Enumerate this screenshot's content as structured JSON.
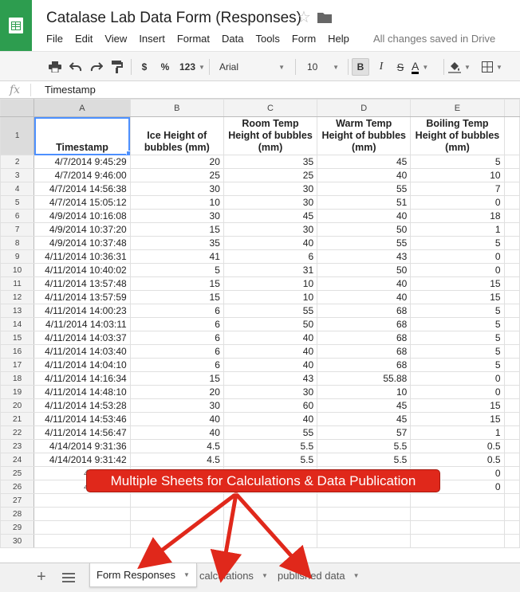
{
  "doc": {
    "title": "Catalase Lab Data Form (Responses)",
    "save_status": "All changes saved in Drive"
  },
  "menu": [
    "File",
    "Edit",
    "View",
    "Insert",
    "Format",
    "Data",
    "Tools",
    "Form",
    "Help"
  ],
  "toolbar": {
    "currency": "$",
    "percent": "%",
    "number_format": "123",
    "font": "Arial",
    "font_size": "10",
    "bold": "B",
    "italic": "I",
    "strike": "S",
    "text_color": "A"
  },
  "formula_bar": {
    "fx": "fx",
    "value": "Timestamp"
  },
  "grid": {
    "columns": [
      "A",
      "B",
      "C",
      "D",
      "E"
    ],
    "headers": [
      "Timestamp",
      "Ice Height of bubbles (mm)",
      "Room Temp Height of bubbles (mm)",
      "Warm Temp Height of bubbles (mm)",
      "Boiling Temp Height of bubbles (mm)"
    ],
    "rows": [
      [
        "4/7/2014 9:45:29",
        "20",
        "35",
        "45",
        "5"
      ],
      [
        "4/7/2014 9:46:00",
        "25",
        "25",
        "40",
        "10"
      ],
      [
        "4/7/2014 14:56:38",
        "30",
        "30",
        "55",
        "7"
      ],
      [
        "4/7/2014 15:05:12",
        "10",
        "30",
        "51",
        "0"
      ],
      [
        "4/9/2014 10:16:08",
        "30",
        "45",
        "40",
        "18"
      ],
      [
        "4/9/2014 10:37:20",
        "15",
        "30",
        "50",
        "1"
      ],
      [
        "4/9/2014 10:37:48",
        "35",
        "40",
        "55",
        "5"
      ],
      [
        "4/11/2014 10:36:31",
        "41",
        "6",
        "43",
        "0"
      ],
      [
        "4/11/2014 10:40:02",
        "5",
        "31",
        "50",
        "0"
      ],
      [
        "4/11/2014 13:57:48",
        "15",
        "10",
        "40",
        "15"
      ],
      [
        "4/11/2014 13:57:59",
        "15",
        "10",
        "40",
        "15"
      ],
      [
        "4/11/2014 14:00:23",
        "6",
        "55",
        "68",
        "5"
      ],
      [
        "4/11/2014 14:03:11",
        "6",
        "50",
        "68",
        "5"
      ],
      [
        "4/11/2014 14:03:37",
        "6",
        "40",
        "68",
        "5"
      ],
      [
        "4/11/2014 14:03:40",
        "6",
        "40",
        "68",
        "5"
      ],
      [
        "4/11/2014 14:04:10",
        "6",
        "40",
        "68",
        "5"
      ],
      [
        "4/11/2014 14:16:34",
        "15",
        "43",
        "55.88",
        "0"
      ],
      [
        "4/11/2014 14:48:10",
        "20",
        "30",
        "10",
        "0"
      ],
      [
        "4/11/2014 14:53:28",
        "30",
        "60",
        "45",
        "15"
      ],
      [
        "4/11/2014 14:53:46",
        "40",
        "40",
        "45",
        "15"
      ],
      [
        "4/11/2014 14:56:47",
        "40",
        "55",
        "57",
        "1"
      ],
      [
        "4/14/2014 9:31:36",
        "4.5",
        "5.5",
        "5.5",
        "0.5"
      ],
      [
        "4/14/2014 9:31:42",
        "4.5",
        "5.5",
        "5.5",
        "0.5"
      ],
      [
        "4/14/2014",
        "",
        "",
        "",
        "0"
      ],
      [
        "4/14/2014",
        "",
        "",
        "",
        "0"
      ],
      [
        "",
        "",
        "",
        "",
        ""
      ],
      [
        "",
        "",
        "",
        "",
        ""
      ],
      [
        "",
        "",
        "",
        "",
        ""
      ],
      [
        "",
        "",
        "",
        "",
        ""
      ]
    ]
  },
  "sheets": [
    {
      "label": "Form Responses",
      "active": true
    },
    {
      "label": "calculations",
      "active": false
    },
    {
      "label": "published data",
      "active": false
    }
  ],
  "annotation": "Multiple Sheets for Calculations & Data Publication",
  "colors": {
    "brand": "#2d9d4f",
    "selection": "#4d90fe",
    "callout": "#e0281b"
  },
  "icons": [
    "sheets-logo-icon",
    "star-icon",
    "folder-icon",
    "print-icon",
    "undo-icon",
    "redo-icon",
    "paint-format-icon",
    "fill-color-icon",
    "borders-icon",
    "add-sheet-icon",
    "sheet-list-icon"
  ]
}
